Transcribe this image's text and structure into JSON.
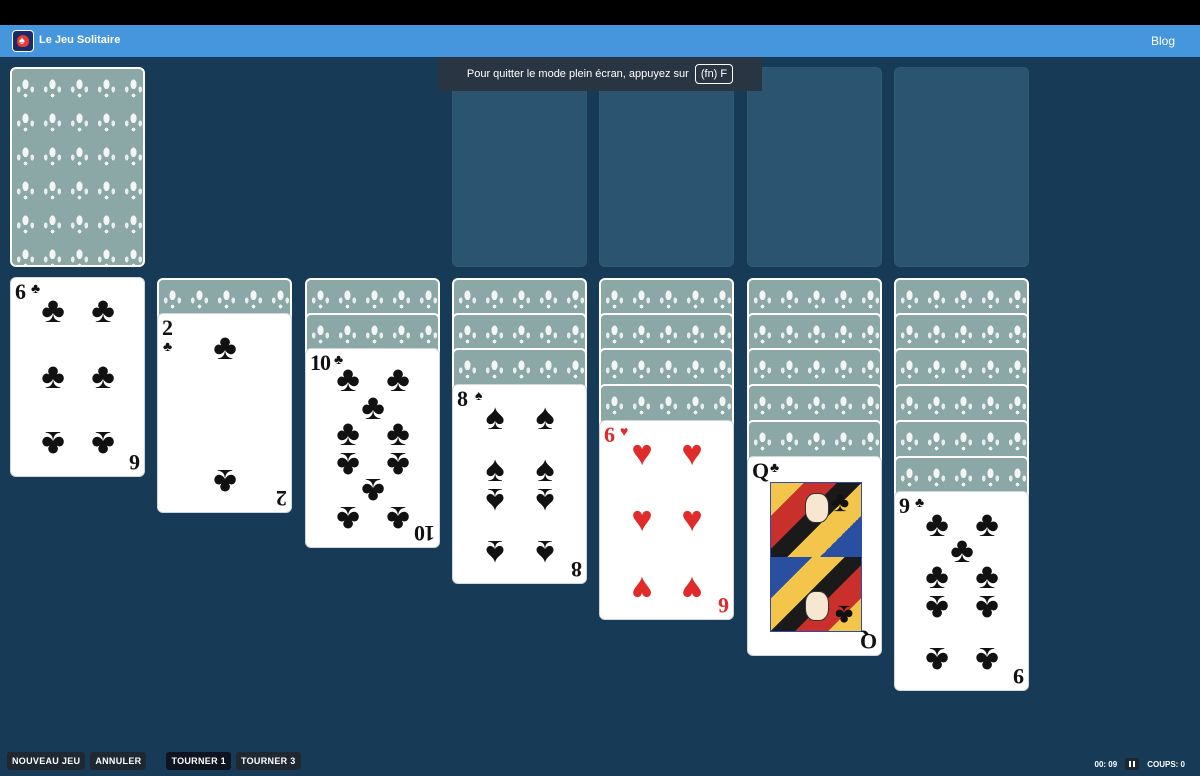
{
  "header": {
    "app_title": "Le Jeu Solitaire",
    "blog_label": "Blog"
  },
  "fullscreen_toast": {
    "message": "Pour quitter le mode plein écran, appuyez sur",
    "key": "(fn) F"
  },
  "tableau": [
    {
      "hidden": 0,
      "card": {
        "rank": "6",
        "suit": "♣",
        "color": "black"
      }
    },
    {
      "hidden": 1,
      "card": {
        "rank": "2",
        "suit": "♣",
        "color": "black"
      }
    },
    {
      "hidden": 2,
      "card": {
        "rank": "10",
        "suit": "♣",
        "color": "black"
      }
    },
    {
      "hidden": 3,
      "card": {
        "rank": "8",
        "suit": "♠",
        "color": "black"
      }
    },
    {
      "hidden": 4,
      "card": {
        "rank": "6",
        "suit": "♥",
        "color": "red"
      }
    },
    {
      "hidden": 5,
      "card": {
        "rank": "Q",
        "suit": "♣",
        "color": "black"
      }
    },
    {
      "hidden": 6,
      "card": {
        "rank": "9",
        "suit": "♣",
        "color": "black"
      }
    }
  ],
  "controls": {
    "new_game": "NOUVEAU JEU",
    "undo": "ANNULER",
    "draw_one": "TOURNER 1",
    "draw_three": "TOURNER 3"
  },
  "status": {
    "timer": "00: 09",
    "moves": "COUPS: 0"
  },
  "colors": {
    "background": "#173a57",
    "header": "#4596dc",
    "slot": "#2a5470",
    "card_back": "#8ba7a6",
    "red_suit": "#e02b2b"
  }
}
